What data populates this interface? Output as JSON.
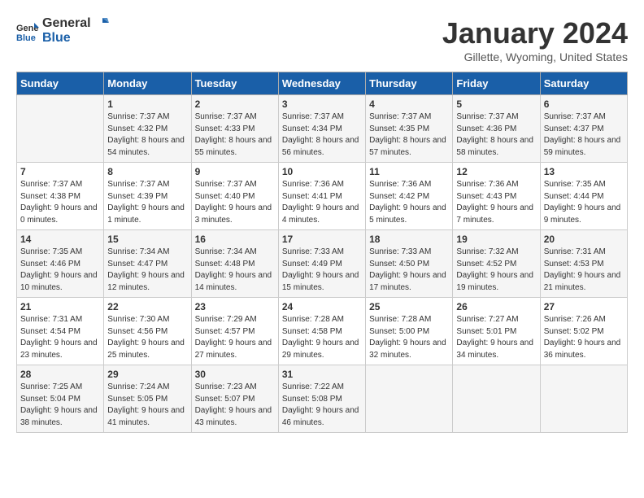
{
  "header": {
    "logo_general": "General",
    "logo_blue": "Blue",
    "month_title": "January 2024",
    "location": "Gillette, Wyoming, United States"
  },
  "days_of_week": [
    "Sunday",
    "Monday",
    "Tuesday",
    "Wednesday",
    "Thursday",
    "Friday",
    "Saturday"
  ],
  "weeks": [
    [
      {
        "day": "",
        "sunrise": "",
        "sunset": "",
        "daylight": ""
      },
      {
        "day": "1",
        "sunrise": "Sunrise: 7:37 AM",
        "sunset": "Sunset: 4:32 PM",
        "daylight": "Daylight: 8 hours and 54 minutes."
      },
      {
        "day": "2",
        "sunrise": "Sunrise: 7:37 AM",
        "sunset": "Sunset: 4:33 PM",
        "daylight": "Daylight: 8 hours and 55 minutes."
      },
      {
        "day": "3",
        "sunrise": "Sunrise: 7:37 AM",
        "sunset": "Sunset: 4:34 PM",
        "daylight": "Daylight: 8 hours and 56 minutes."
      },
      {
        "day": "4",
        "sunrise": "Sunrise: 7:37 AM",
        "sunset": "Sunset: 4:35 PM",
        "daylight": "Daylight: 8 hours and 57 minutes."
      },
      {
        "day": "5",
        "sunrise": "Sunrise: 7:37 AM",
        "sunset": "Sunset: 4:36 PM",
        "daylight": "Daylight: 8 hours and 58 minutes."
      },
      {
        "day": "6",
        "sunrise": "Sunrise: 7:37 AM",
        "sunset": "Sunset: 4:37 PM",
        "daylight": "Daylight: 8 hours and 59 minutes."
      }
    ],
    [
      {
        "day": "7",
        "sunrise": "Sunrise: 7:37 AM",
        "sunset": "Sunset: 4:38 PM",
        "daylight": "Daylight: 9 hours and 0 minutes."
      },
      {
        "day": "8",
        "sunrise": "Sunrise: 7:37 AM",
        "sunset": "Sunset: 4:39 PM",
        "daylight": "Daylight: 9 hours and 1 minute."
      },
      {
        "day": "9",
        "sunrise": "Sunrise: 7:37 AM",
        "sunset": "Sunset: 4:40 PM",
        "daylight": "Daylight: 9 hours and 3 minutes."
      },
      {
        "day": "10",
        "sunrise": "Sunrise: 7:36 AM",
        "sunset": "Sunset: 4:41 PM",
        "daylight": "Daylight: 9 hours and 4 minutes."
      },
      {
        "day": "11",
        "sunrise": "Sunrise: 7:36 AM",
        "sunset": "Sunset: 4:42 PM",
        "daylight": "Daylight: 9 hours and 5 minutes."
      },
      {
        "day": "12",
        "sunrise": "Sunrise: 7:36 AM",
        "sunset": "Sunset: 4:43 PM",
        "daylight": "Daylight: 9 hours and 7 minutes."
      },
      {
        "day": "13",
        "sunrise": "Sunrise: 7:35 AM",
        "sunset": "Sunset: 4:44 PM",
        "daylight": "Daylight: 9 hours and 9 minutes."
      }
    ],
    [
      {
        "day": "14",
        "sunrise": "Sunrise: 7:35 AM",
        "sunset": "Sunset: 4:46 PM",
        "daylight": "Daylight: 9 hours and 10 minutes."
      },
      {
        "day": "15",
        "sunrise": "Sunrise: 7:34 AM",
        "sunset": "Sunset: 4:47 PM",
        "daylight": "Daylight: 9 hours and 12 minutes."
      },
      {
        "day": "16",
        "sunrise": "Sunrise: 7:34 AM",
        "sunset": "Sunset: 4:48 PM",
        "daylight": "Daylight: 9 hours and 14 minutes."
      },
      {
        "day": "17",
        "sunrise": "Sunrise: 7:33 AM",
        "sunset": "Sunset: 4:49 PM",
        "daylight": "Daylight: 9 hours and 15 minutes."
      },
      {
        "day": "18",
        "sunrise": "Sunrise: 7:33 AM",
        "sunset": "Sunset: 4:50 PM",
        "daylight": "Daylight: 9 hours and 17 minutes."
      },
      {
        "day": "19",
        "sunrise": "Sunrise: 7:32 AM",
        "sunset": "Sunset: 4:52 PM",
        "daylight": "Daylight: 9 hours and 19 minutes."
      },
      {
        "day": "20",
        "sunrise": "Sunrise: 7:31 AM",
        "sunset": "Sunset: 4:53 PM",
        "daylight": "Daylight: 9 hours and 21 minutes."
      }
    ],
    [
      {
        "day": "21",
        "sunrise": "Sunrise: 7:31 AM",
        "sunset": "Sunset: 4:54 PM",
        "daylight": "Daylight: 9 hours and 23 minutes."
      },
      {
        "day": "22",
        "sunrise": "Sunrise: 7:30 AM",
        "sunset": "Sunset: 4:56 PM",
        "daylight": "Daylight: 9 hours and 25 minutes."
      },
      {
        "day": "23",
        "sunrise": "Sunrise: 7:29 AM",
        "sunset": "Sunset: 4:57 PM",
        "daylight": "Daylight: 9 hours and 27 minutes."
      },
      {
        "day": "24",
        "sunrise": "Sunrise: 7:28 AM",
        "sunset": "Sunset: 4:58 PM",
        "daylight": "Daylight: 9 hours and 29 minutes."
      },
      {
        "day": "25",
        "sunrise": "Sunrise: 7:28 AM",
        "sunset": "Sunset: 5:00 PM",
        "daylight": "Daylight: 9 hours and 32 minutes."
      },
      {
        "day": "26",
        "sunrise": "Sunrise: 7:27 AM",
        "sunset": "Sunset: 5:01 PM",
        "daylight": "Daylight: 9 hours and 34 minutes."
      },
      {
        "day": "27",
        "sunrise": "Sunrise: 7:26 AM",
        "sunset": "Sunset: 5:02 PM",
        "daylight": "Daylight: 9 hours and 36 minutes."
      }
    ],
    [
      {
        "day": "28",
        "sunrise": "Sunrise: 7:25 AM",
        "sunset": "Sunset: 5:04 PM",
        "daylight": "Daylight: 9 hours and 38 minutes."
      },
      {
        "day": "29",
        "sunrise": "Sunrise: 7:24 AM",
        "sunset": "Sunset: 5:05 PM",
        "daylight": "Daylight: 9 hours and 41 minutes."
      },
      {
        "day": "30",
        "sunrise": "Sunrise: 7:23 AM",
        "sunset": "Sunset: 5:07 PM",
        "daylight": "Daylight: 9 hours and 43 minutes."
      },
      {
        "day": "31",
        "sunrise": "Sunrise: 7:22 AM",
        "sunset": "Sunset: 5:08 PM",
        "daylight": "Daylight: 9 hours and 46 minutes."
      },
      {
        "day": "",
        "sunrise": "",
        "sunset": "",
        "daylight": ""
      },
      {
        "day": "",
        "sunrise": "",
        "sunset": "",
        "daylight": ""
      },
      {
        "day": "",
        "sunrise": "",
        "sunset": "",
        "daylight": ""
      }
    ]
  ]
}
